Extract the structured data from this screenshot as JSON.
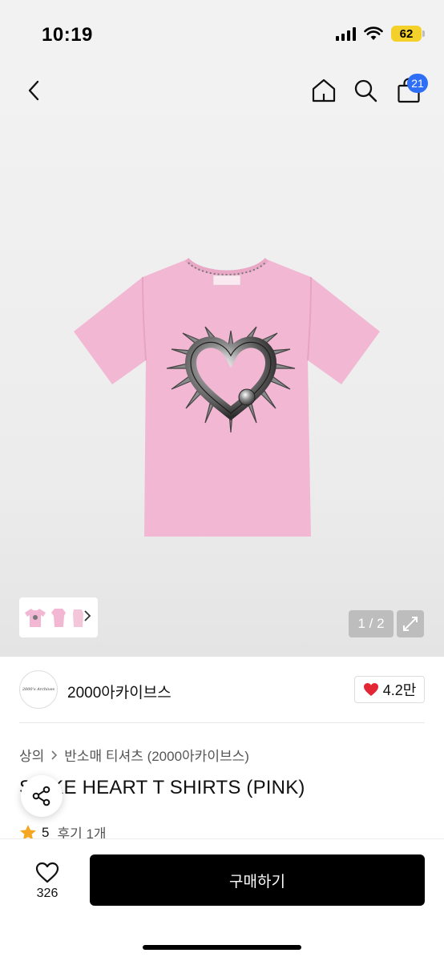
{
  "status": {
    "time": "10:19",
    "battery": "62"
  },
  "nav": {
    "cart_count": "21"
  },
  "gallery": {
    "pager": "1 / 2"
  },
  "brand": {
    "name": "2000아카이브스",
    "logo_text": "2000's Archives",
    "likes": "4.2만"
  },
  "breadcrumb": {
    "category": "상의",
    "subcategory": "반소매 티셔츠 (2000아카이브스)"
  },
  "product": {
    "title": "SPIKE HEART T SHIRTS (PINK)",
    "visible_title": "E HEART T SHIRTS (PINK)"
  },
  "rating": {
    "score": "5",
    "reviews": "후기 1개"
  },
  "bottom": {
    "wish_count": "326",
    "buy_label": "구매하기"
  },
  "colors": {
    "accent_badge": "#2f6ff6",
    "heart": "#e32636",
    "star": "#f5a623",
    "shirt": "#f2b8d3"
  },
  "icons": [
    "back-arrow-icon",
    "home-icon",
    "search-icon",
    "bag-icon",
    "expand-icon",
    "share-icon",
    "heart-icon",
    "star-icon",
    "chevron-right-icon"
  ]
}
